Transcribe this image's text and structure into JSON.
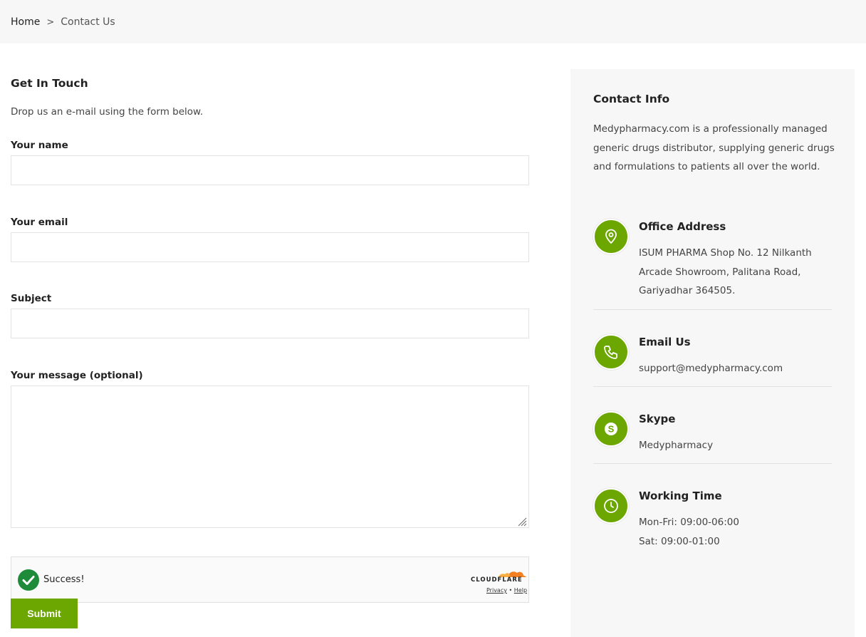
{
  "breadcrumb": {
    "home": "Home",
    "separator": ">",
    "current": "Contact Us"
  },
  "form": {
    "title": "Get In Touch",
    "intro": "Drop us an e-mail using the form below.",
    "name_label": "Your name",
    "name_value": "",
    "email_label": "Your email",
    "email_value": "",
    "subject_label": "Subject",
    "subject_value": "",
    "message_label": "Your message (optional)",
    "message_value": "",
    "submit_label": "Submit"
  },
  "captcha": {
    "status": "Success!",
    "brand": "CLOUDFLARE",
    "privacy_label": "Privacy",
    "link_separator": "•",
    "help_label": "Help"
  },
  "contact_info": {
    "title": "Contact Info",
    "description": "Medypharmacy.com is a professionally managed generic drugs distributor, supplying generic drugs and formulations to patients all over the world.",
    "items": [
      {
        "icon": "map-pin-icon",
        "title": "Office Address",
        "lines": [
          "ISUM PHARMA Shop No. 12 Nilkanth Arcade Showroom, Palitana Road, Gariyadhar 364505."
        ]
      },
      {
        "icon": "phone-icon",
        "title": "Email Us",
        "lines": [
          "support@medypharmacy.com"
        ]
      },
      {
        "icon": "skype-icon",
        "title": "Skype",
        "lines": [
          "Medypharmacy"
        ]
      },
      {
        "icon": "clock-icon",
        "title": "Working Time",
        "lines": [
          "Mon-Fri: 09:00-06:00",
          "Sat: 09:00-01:00"
        ]
      }
    ]
  },
  "colors": {
    "accent": "#6ca600",
    "panel_bg": "#f7f7f7",
    "captcha_check": "#1e8b3a",
    "cloudflare_orange": "#f38020"
  }
}
